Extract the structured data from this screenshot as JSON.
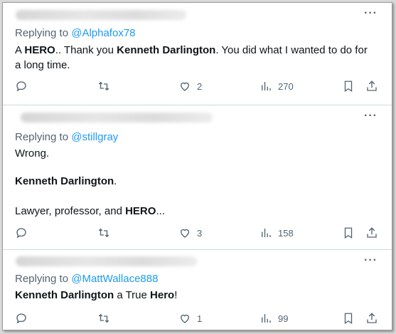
{
  "tweets": [
    {
      "replying_prefix": "Replying to ",
      "handle": "@Alphafox78",
      "body": {
        "l1a": "A ",
        "l1b": "HERO",
        "l1c": ".. Thank you ",
        "l1d": "Kenneth Darlington",
        "l1e": ". You did what I wanted to do for",
        "l2": "a long time."
      },
      "more": "···",
      "likes": "2",
      "views": "270"
    },
    {
      "replying_prefix": "Replying to ",
      "handle": "@stillgray",
      "body": {
        "l1": "Wrong.",
        "l2a": "Kenneth Darlington",
        "l2b": ".",
        "l3a": "Lawyer, professor, and ",
        "l3b": "HERO",
        "l3c": "..."
      },
      "more": "···",
      "likes": "3",
      "views": "158"
    },
    {
      "replying_prefix": "Replying to ",
      "handle": "@MattWallace888",
      "body": {
        "l1a": "Kenneth Darlington",
        "l1b": " a True ",
        "l1c": "Hero",
        "l1d": "!"
      },
      "more": "···",
      "likes": "1",
      "views": "99"
    }
  ],
  "colors": {
    "link": "#1d9bf0",
    "muted": "#536471",
    "divider": "#cfd9de"
  }
}
